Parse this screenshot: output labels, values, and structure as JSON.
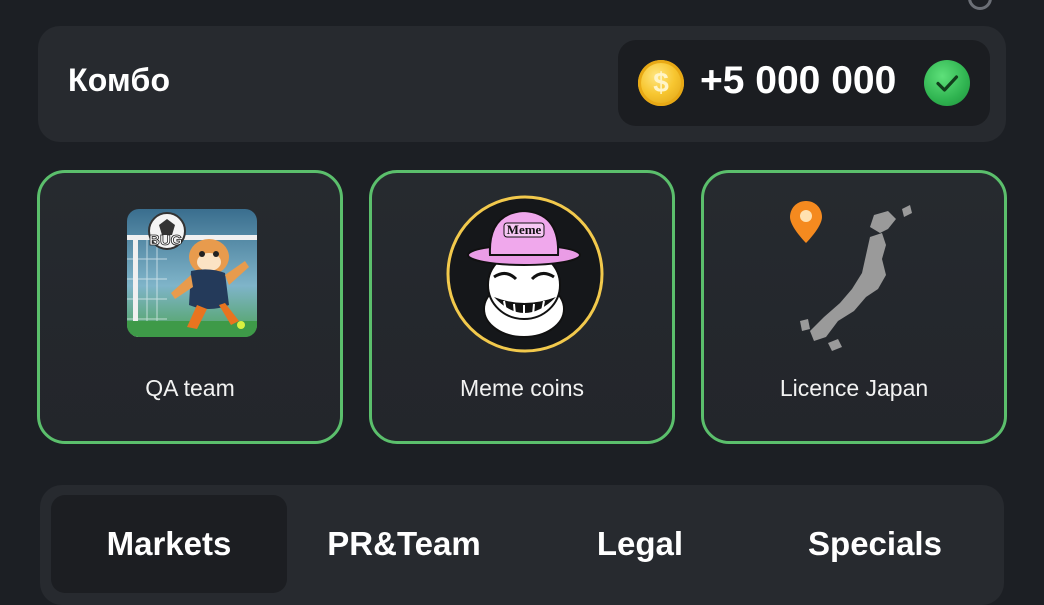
{
  "combo": {
    "title": "Комбо",
    "reward_amount": "+5 000 000",
    "coin_symbol": "$",
    "reward_icon": "coin-icon",
    "status_icon": "check-icon"
  },
  "cards": [
    {
      "label": "QA team",
      "image": "hamster-goalkeeper-bug-image",
      "badge": "BUG"
    },
    {
      "label": "Meme coins",
      "image": "troll-face-meme-hat-image",
      "badge": "Meme"
    },
    {
      "label": "Licence Japan",
      "image": "japan-map-pin-image"
    }
  ],
  "tabs": {
    "items": [
      {
        "label": "Markets",
        "active": true
      },
      {
        "label": "PR&Team",
        "active": false
      },
      {
        "label": "Legal",
        "active": false
      },
      {
        "label": "Specials",
        "active": false
      }
    ]
  },
  "colors": {
    "background": "#1c1f24",
    "panel": "#272a2f",
    "card_border": "#5bbf6c",
    "coin": "#f7c630",
    "check": "#2fb350"
  }
}
